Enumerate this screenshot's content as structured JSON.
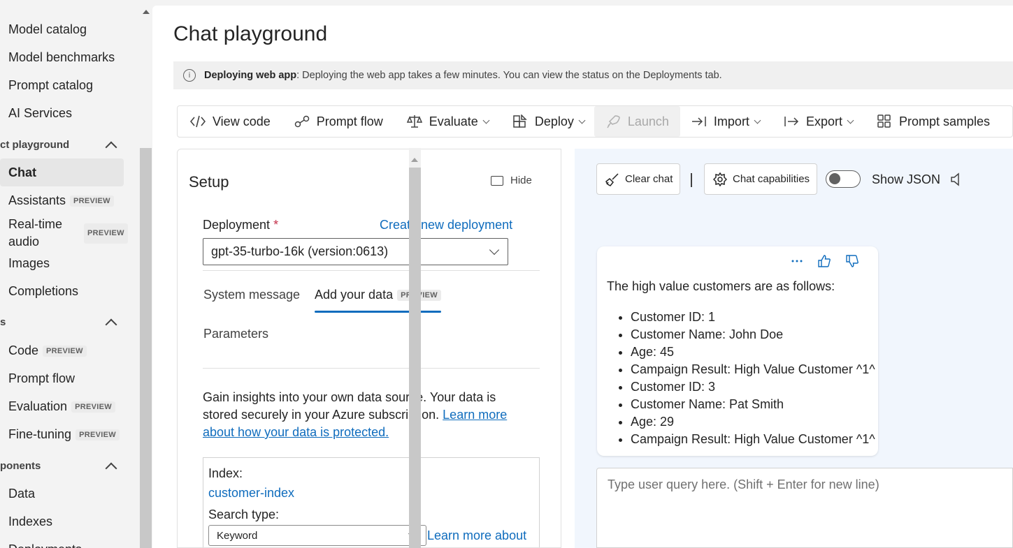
{
  "sidebar": {
    "items_top": [
      {
        "label": "Model catalog"
      },
      {
        "label": "Model benchmarks"
      },
      {
        "label": "Prompt catalog"
      },
      {
        "label": "AI Services"
      }
    ],
    "section_playground": "ct playground",
    "playground_items": [
      {
        "label": "Chat"
      },
      {
        "label": "Assistants",
        "badge": "PREVIEW"
      },
      {
        "label_line1": "Real-time",
        "label_line2": "audio",
        "badge": "PREVIEW"
      },
      {
        "label": "Images"
      },
      {
        "label": "Completions"
      }
    ],
    "section_tools": "s",
    "tools_items": [
      {
        "label": "Code",
        "badge": "PREVIEW"
      },
      {
        "label": "Prompt flow"
      },
      {
        "label": "Evaluation",
        "badge": "PREVIEW"
      },
      {
        "label": "Fine-tuning",
        "badge": "PREVIEW"
      }
    ],
    "section_components": "ponents",
    "component_items": [
      {
        "label": "Data"
      },
      {
        "label": "Indexes"
      },
      {
        "label": "Deployments"
      }
    ]
  },
  "page": {
    "title": "Chat playground",
    "banner_bold": "Deploying web app",
    "banner_text": ": Deploying the web app takes a few minutes. You can view the status on the Deployments tab."
  },
  "toolbar": {
    "view_code": "View code",
    "prompt_flow": "Prompt flow",
    "evaluate": "Evaluate",
    "deploy": "Deploy",
    "launch": "Launch",
    "import": "Import",
    "export": "Export",
    "prompt_samples": "Prompt samples"
  },
  "setup": {
    "title": "Setup",
    "hide": "Hide",
    "deployment_label": "Deployment",
    "required_mark": "*",
    "create_link": "Create new deployment",
    "deployment_value": "gpt-35-turbo-16k (version:0613)",
    "tabs": {
      "system_message": "System message",
      "add_your_data": "Add your data",
      "add_your_data_badge": "PREVIEW",
      "parameters": "Parameters"
    },
    "desc_text": "Gain insights into your own data source. Your data is stored securely in your Azure subscription. ",
    "desc_link": "Learn more about how your data is protected.",
    "index_label": "Index:",
    "index_value": "customer-index",
    "search_type_label": "Search type:",
    "search_type_value": "Keyword",
    "learn_more": "Learn more about"
  },
  "chat": {
    "clear_chat": "Clear chat",
    "chat_capabilities": "Chat capabilities",
    "show_json": "Show JSON",
    "show_json_on": false,
    "message_intro": "The high value customers are as follows:",
    "message_items": [
      "Customer ID: 1",
      "Customer Name: John Doe",
      "Age: 45",
      "Campaign Result: High Value Customer ^1^",
      "Customer ID: 3",
      "Customer Name: Pat Smith",
      "Age: 29",
      "Campaign Result: High Value Customer ^1^"
    ],
    "query_placeholder": "Type user query here. (Shift + Enter for new line)"
  },
  "colors": {
    "accent": "#0f6cbd",
    "chat_bg": "#f1f6fd",
    "required": "#c4314b"
  }
}
